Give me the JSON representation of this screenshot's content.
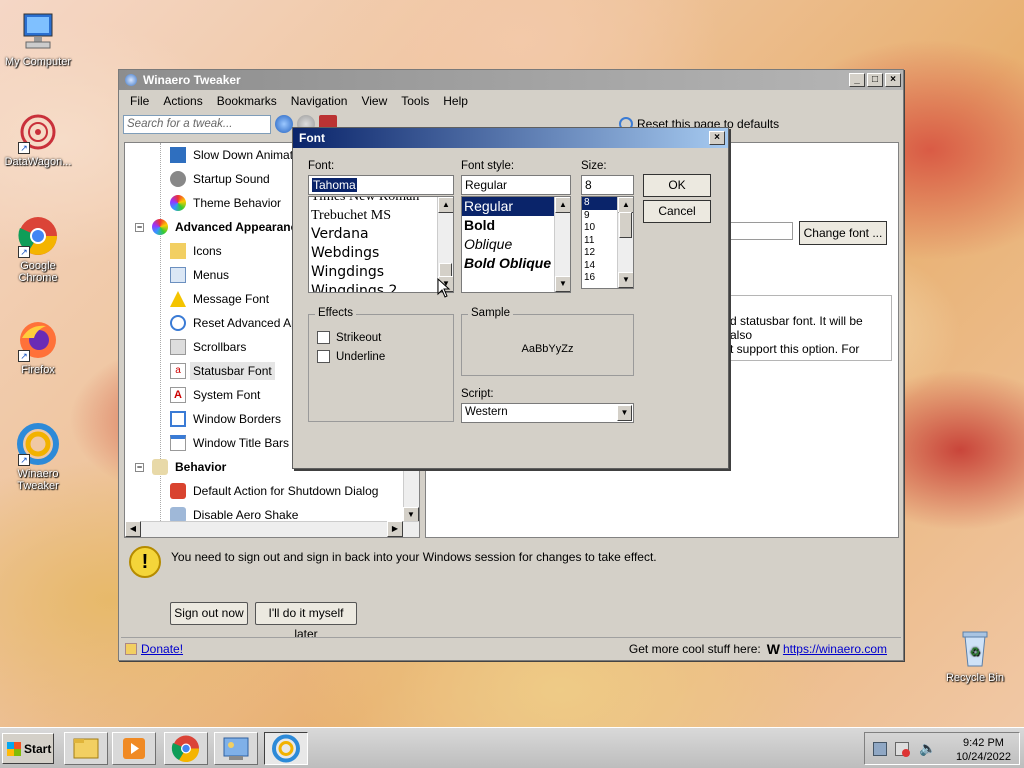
{
  "desktop": {
    "icons": [
      {
        "label": "My Computer"
      },
      {
        "label": "DataWagon..."
      },
      {
        "label": "Google Chrome"
      },
      {
        "label": "Firefox"
      },
      {
        "label": "Winaero Tweaker"
      },
      {
        "label": "Recycle Bin"
      }
    ]
  },
  "window": {
    "title": "Winaero Tweaker",
    "menu": [
      "File",
      "Actions",
      "Bookmarks",
      "Navigation",
      "View",
      "Tools",
      "Help"
    ],
    "search_placeholder": "Search for a tweak...",
    "reset_label": "Reset this page to defaults",
    "tree": {
      "items": [
        {
          "label": "Slow Down Animations",
          "type": "child"
        },
        {
          "label": "Startup Sound",
          "type": "child"
        },
        {
          "label": "Theme Behavior",
          "type": "child"
        },
        {
          "label": "Advanced Appearance",
          "type": "group"
        },
        {
          "label": "Icons",
          "type": "child"
        },
        {
          "label": "Menus",
          "type": "child"
        },
        {
          "label": "Message Font",
          "type": "child"
        },
        {
          "label": "Reset Advanced Appearance",
          "type": "child"
        },
        {
          "label": "Scrollbars",
          "type": "child"
        },
        {
          "label": "Statusbar Font",
          "type": "child",
          "selected": true
        },
        {
          "label": "System Font",
          "type": "child"
        },
        {
          "label": "Window Borders",
          "type": "child"
        },
        {
          "label": "Window Title Bars",
          "type": "child"
        },
        {
          "label": "Behavior",
          "type": "group"
        },
        {
          "label": "Default Action for Shutdown Dialog",
          "type": "child"
        },
        {
          "label": "Disable Aero Shake",
          "type": "child"
        }
      ]
    },
    "change_font_label": "Change font ...",
    "description_line1": "d statusbar font. It will be also",
    "description_line2": "t support this option. For",
    "notice": "You need to sign out and sign in back into your Windows session for changes to take effect.",
    "sign_out_label": "Sign out now",
    "later_label": "I'll do it myself later",
    "donate_label": "Donate!",
    "more_stuff": "Get more cool stuff here:",
    "winaero_link": "https://winaero.com"
  },
  "font_dialog": {
    "title": "Font",
    "font_label": "Font:",
    "font_value": "Tahoma",
    "font_list": [
      "Times New Roman",
      "Trebuchet MS",
      "Verdana",
      "Webdings",
      "Wingdings",
      "Wingdings 2"
    ],
    "style_label": "Font style:",
    "style_value": "Regular",
    "style_list": [
      "Regular",
      "Bold",
      "Oblique",
      "Bold Oblique"
    ],
    "size_label": "Size:",
    "size_value": "8",
    "size_list": [
      "8",
      "9",
      "10",
      "11",
      "12",
      "14",
      "16"
    ],
    "ok_label": "OK",
    "cancel_label": "Cancel",
    "effects_label": "Effects",
    "strikeout_label": "Strikeout",
    "underline_label": "Underline",
    "sample_label": "Sample",
    "sample_text": "AaBbYyZz",
    "script_label": "Script:",
    "script_value": "Western"
  },
  "taskbar": {
    "start_label": "Start",
    "time": "9:42 PM",
    "date": "10/24/2022"
  }
}
